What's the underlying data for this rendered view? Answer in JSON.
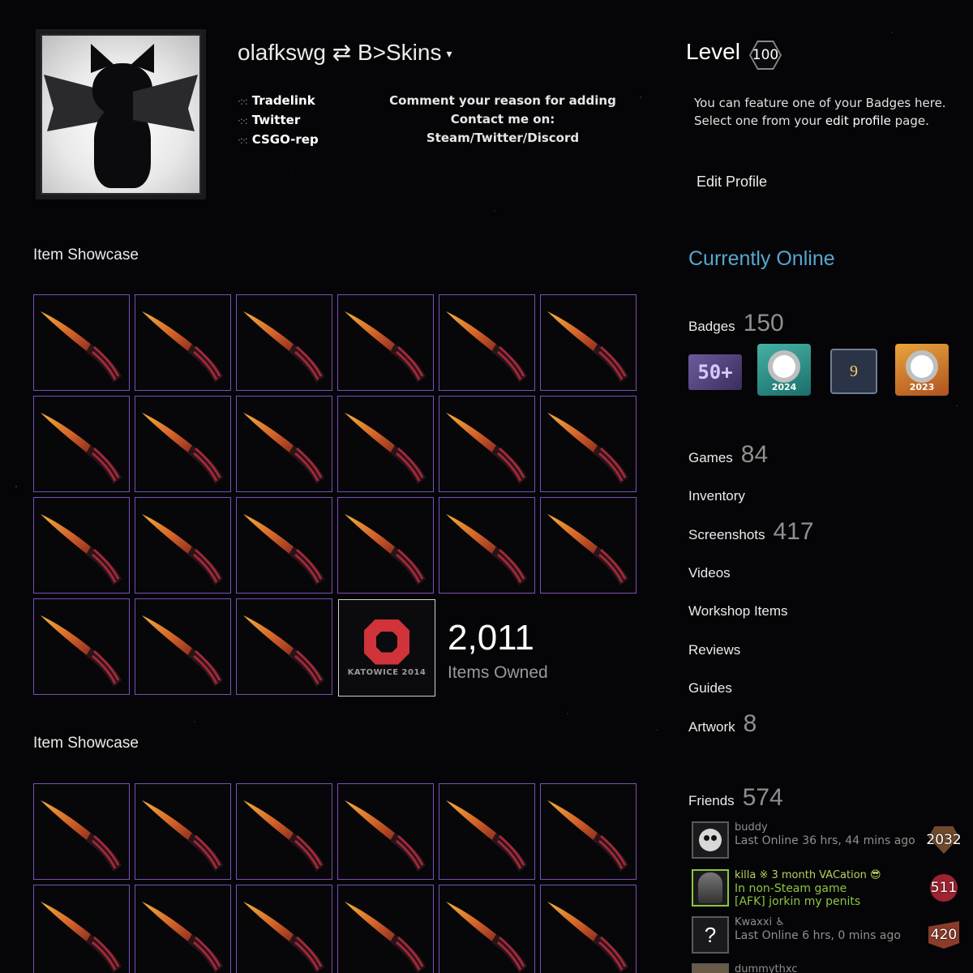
{
  "profile": {
    "persona_name": "olafkswg ⇄ B>Skins",
    "dropdown_caret": "▾",
    "links": [
      {
        "dots": "·:·:",
        "label": "Tradelink"
      },
      {
        "dots": "·:·:",
        "label": "Twitter"
      },
      {
        "dots": "·:·:",
        "label": "CSGO-rep"
      }
    ],
    "summary_lines": [
      "Comment your reason for adding",
      "Contact me on: Steam/Twitter/Discord"
    ]
  },
  "level": {
    "label": "Level",
    "value": "100"
  },
  "badge_note": {
    "line1": "You can feature one of your Badges here.",
    "line2_prefix": "Select one from your ",
    "line2_link": "edit profile",
    "line2_suffix": " page."
  },
  "edit_profile_label": "Edit Profile",
  "showcase_1": {
    "title": "Item Showcase",
    "sticker_text": "KATOWICE 2014",
    "items_count": "2,011",
    "items_label": "Items Owned"
  },
  "showcase_2": {
    "title": "Item Showcase"
  },
  "status": "Currently Online",
  "badges": {
    "label": "Badges",
    "count": "150",
    "icons": [
      {
        "icon": "fifty-plus-badge-icon",
        "text": "50+"
      },
      {
        "icon": "steam-2024-badge-icon",
        "text": "2024"
      },
      {
        "icon": "years-of-service-badge-icon",
        "text": "9"
      },
      {
        "icon": "steam-2023-badge-icon",
        "text": "2023"
      }
    ]
  },
  "stats": [
    {
      "label": "Games",
      "count": "84"
    },
    {
      "label": "Inventory",
      "count": ""
    },
    {
      "label": "Screenshots",
      "count": "417"
    },
    {
      "label": "Videos",
      "count": ""
    },
    {
      "label": "Workshop Items",
      "count": ""
    },
    {
      "label": "Reviews",
      "count": ""
    },
    {
      "label": "Guides",
      "count": ""
    },
    {
      "label": "Artwork",
      "count": "8"
    }
  ],
  "friends": {
    "label": "Friends",
    "count": "574",
    "list": [
      {
        "name": "buddy",
        "status": "Last Online 36 hrs, 44 mins ago",
        "status2": "",
        "level": "2032"
      },
      {
        "name": "killa ※ 3 month VACation 😎",
        "status": "In non-Steam game",
        "status2": "[AFK] jorkin my penits",
        "level": "511"
      },
      {
        "name": "Kwaxxi ♿",
        "status": "Last Online 6 hrs, 0 mins ago",
        "status2": "",
        "level": "420"
      },
      {
        "name": "dummythxc",
        "status": "",
        "status2": "",
        "level": ""
      }
    ]
  },
  "colors": {
    "background": "#050507",
    "item_border": "#7b4fb5",
    "online_status": "#57a7d1",
    "ingame_green": "#8bc53f"
  }
}
